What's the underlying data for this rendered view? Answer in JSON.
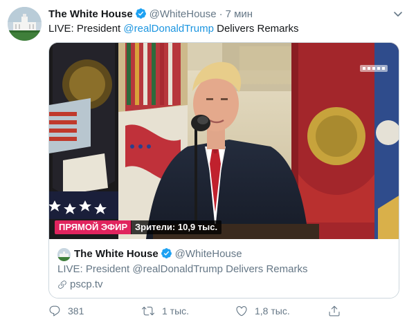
{
  "tweet": {
    "author_name": "The White House",
    "author_handle": "@WhiteHouse",
    "separator": "·",
    "time": "7 мин",
    "text_prefix": "LIVE: President ",
    "text_mention": "@realDonaldTrump",
    "text_suffix": " Delivers Remarks"
  },
  "media": {
    "live_label": "ПРЯМОЙ ЭФИР",
    "viewers_label": "Зрители: 10,9 тыс."
  },
  "card": {
    "author_name": "The White House",
    "author_handle": "@WhiteHouse",
    "text": "LIVE: President @realDonaldTrump Delivers Remarks",
    "link": "pscp.tv"
  },
  "actions": {
    "replies": "381",
    "retweets": "1 тыс.",
    "likes": "1,8 тыс."
  },
  "colors": {
    "accent": "#1b95e0",
    "verified": "#1da1f2",
    "live_badge": "#e0245e",
    "secondary_text": "#657786"
  },
  "icons": [
    "verified-badge-icon",
    "caret-down-icon",
    "link-icon",
    "reply-icon",
    "retweet-icon",
    "like-icon",
    "share-icon"
  ]
}
